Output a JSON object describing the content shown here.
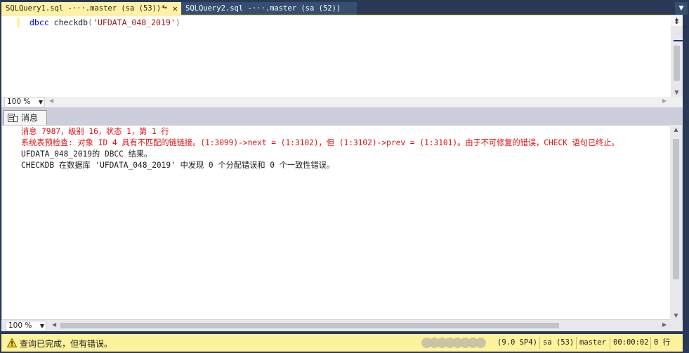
{
  "tabs": [
    {
      "label": "SQLQuery1.sql -···.master (sa (53))*",
      "pin": "⊸",
      "close": "✕",
      "active": true
    },
    {
      "label": "SQLQuery2.sql -···.master (sa (52))",
      "active": false
    }
  ],
  "tabstrip_menu_icon": "chevron-down",
  "editor": {
    "code": {
      "keyword": "dbcc",
      "function": "checkdb",
      "open": "(",
      "string": "'UFDATA_048_2019'",
      "close": ")"
    },
    "zoom": "100 %"
  },
  "results": {
    "tab_label": "消息",
    "messages": [
      {
        "text": "消息 7987，级别 16，状态 1，第 1 行",
        "type": "error"
      },
      {
        "text": "系统表预检查: 对象 ID 4 具有不匹配的链链接。(1:3099)->next = (1:3102)，但 (1:3102)->prev = (1:3101)。由于不可修复的错误，CHECK 语句已终止。",
        "type": "error"
      },
      {
        "text": "UFDATA_048_2019的 DBCC 结果。",
        "type": "info"
      },
      {
        "text": "CHECKDB 在数据库 'UFDATA_048_2019' 中发现 0 个分配错误和 0 个一致性错误。",
        "type": "info"
      }
    ],
    "zoom": "100 %"
  },
  "status": {
    "text": "查询已完成，但有错误。",
    "version": "(9.0 SP4)",
    "user": "sa (53)",
    "database": "master",
    "elapsed": "00:00:02",
    "rows": "0 行"
  },
  "colors": {
    "tab_active": "#fff1a8",
    "status_bar": "#fff29d",
    "error_text": "#e01010",
    "keyword": "#0000ff",
    "string": "#a31515"
  }
}
